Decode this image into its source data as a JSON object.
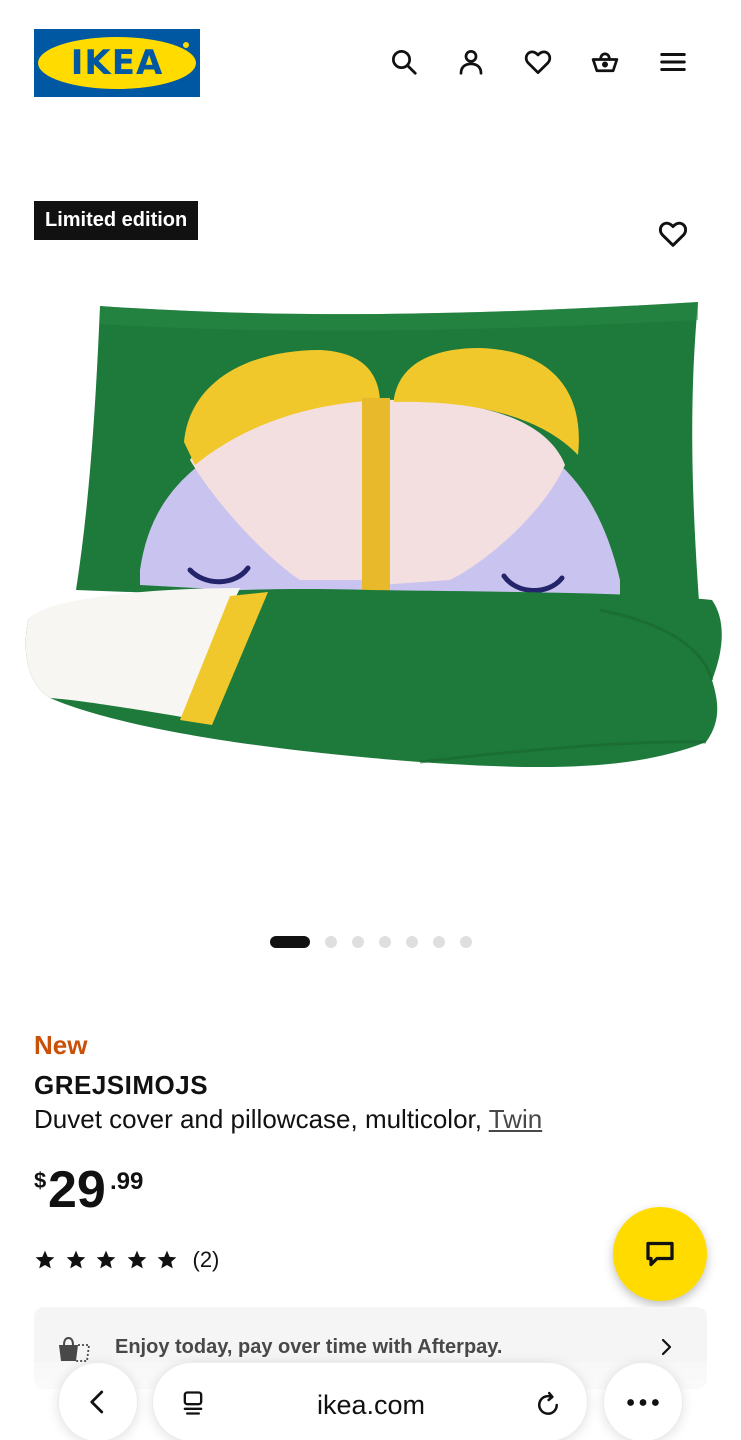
{
  "header": {
    "logo_text": "IKEA",
    "icons": [
      "search-icon",
      "user-icon",
      "heart-icon",
      "cart-icon",
      "menu-icon"
    ]
  },
  "product": {
    "badge": "Limited edition",
    "new_label": "New",
    "name": "GREJSIMOJS",
    "description": "Duvet cover and pillowcase, multicolor, ",
    "size": "Twin",
    "price": {
      "currency": "$",
      "integer": "29",
      "decimal": ".99"
    },
    "rating": 5,
    "review_count": "(2)",
    "image_count": 7,
    "active_image": 0
  },
  "afterpay": {
    "text": "Enjoy today, pay over time with Afterpay."
  },
  "browser": {
    "url": "ikea.com"
  },
  "colors": {
    "ikea_blue": "#0058a3",
    "ikea_yellow": "#ffdb00",
    "new_orange": "#ca5008",
    "product_green": "#1e7a3b",
    "product_lilac": "#c9c3ef",
    "product_pink": "#f4dfe0"
  }
}
